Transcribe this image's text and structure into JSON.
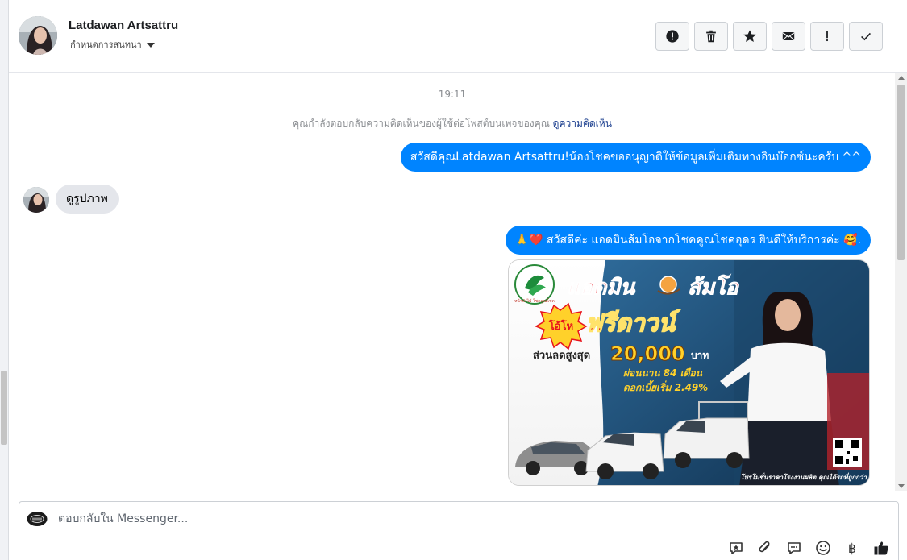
{
  "header": {
    "contact_name": "Latdawan Artsattru",
    "subtitle": "กำหนดการสนทนา",
    "toolbar": [
      {
        "name": "report-spam-button",
        "icon": "alert-circle-icon"
      },
      {
        "name": "delete-button",
        "icon": "trash-icon"
      },
      {
        "name": "star-button",
        "icon": "star-icon"
      },
      {
        "name": "mark-unread-button",
        "icon": "envelope-icon"
      },
      {
        "name": "follow-up-button",
        "icon": "exclamation-icon"
      },
      {
        "name": "mark-done-button",
        "icon": "checkmark-icon"
      }
    ]
  },
  "conversation": {
    "timestamp": "19:11",
    "context_text": "คุณกำลังตอบกลับความคิดเห็นของผู้ใช้ต่อโพสต์บนเพจของคุณ",
    "context_link": "ดูความคิดเห็น",
    "messages": [
      {
        "direction": "outgoing",
        "text": "สวัสดีคุณLatdawan Artsattru!น้องโชคขออนุญาติให้ข้อมูลเพิ่มเติมทางอินบ๊อกซ์นะครับ ^^"
      },
      {
        "direction": "incoming",
        "text": "ดูรูปภาพ"
      },
      {
        "direction": "outgoing",
        "text": "🙏❤️ สวัสดีค่ะ แอดมินส้มโอจากโชคคูณโชคอุดร ยินดีให้บริการค่ะ 🥰."
      }
    ],
    "promo": {
      "headline_left": "แอดมิน",
      "headline_right": "ส้มโอ",
      "badge": "โอ้โห",
      "free_down": "ฟรีดาวน์",
      "discount_label": "ส่วนลดสูงสุด",
      "discount_amount": "20,000",
      "discount_unit": "บาท",
      "installment": "ผ่อนนาน 84 เดือน",
      "interest": "ดอกเบี้ยเริ่ม 2.49%",
      "footer": "โปรโมชั่นราคาโรงงานผลิต คุณได้รถที่ถูกกว่า",
      "logo_small_text": "หน้าป่าไม้ โชคคูณโชค"
    }
  },
  "composer": {
    "placeholder": "ตอบกลับใน Messenger...",
    "tools": [
      "saved-replies-icon",
      "attachment-icon",
      "chat-bubble-icon",
      "emoji-icon",
      "baht-icon",
      "thumbs-up-icon"
    ],
    "baht_symbol": "฿"
  },
  "colors": {
    "outgoing_bubble": "#0084ff",
    "incoming_bubble": "#e4e6eb",
    "link": "#1c3f8f"
  }
}
